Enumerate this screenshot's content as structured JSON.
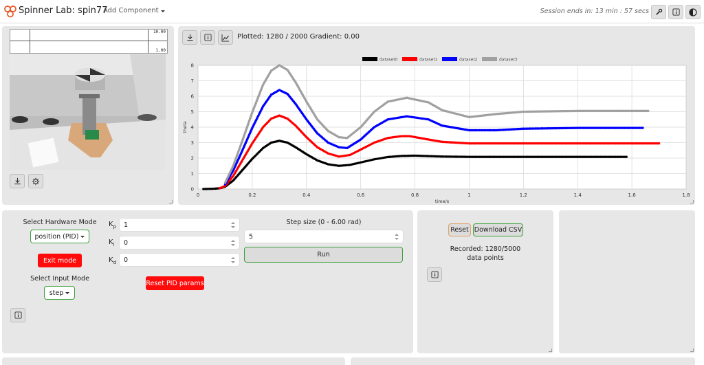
{
  "topbar": {
    "title": "Spinner Lab: spin77",
    "add_component": "Add Component",
    "session": "Session ends in: 13 min : 57 secs",
    "icons": [
      "wrench-icon",
      "info-icon",
      "contrast-icon"
    ]
  },
  "camera_panel": {
    "overlay_top": "10.00",
    "overlay_bottom": "1.00",
    "buttons": [
      "download-icon",
      "gear-icon"
    ]
  },
  "plot_panel": {
    "status": "Plotted: 1280 / 2000  Gradient: 0.00",
    "buttons": [
      "download-icon",
      "info-icon",
      "chart-icon"
    ]
  },
  "chart_data": {
    "type": "scatter",
    "xlabel": "time/s",
    "ylabel": "theta",
    "xlim": [
      0,
      1.8
    ],
    "ylim": [
      0,
      8
    ],
    "xticks": [
      "0",
      "0.2",
      "0.4",
      "0.6",
      "0.8",
      "1",
      "1.2",
      "1.4",
      "1.6",
      "1.8"
    ],
    "yticks": [
      "0",
      "1",
      "2",
      "3",
      "4",
      "5",
      "6",
      "7",
      "8"
    ],
    "grid": true,
    "legend_position": "top-center",
    "series": [
      {
        "name": "dataset0",
        "color": "#000000",
        "x": [
          0.02,
          0.06,
          0.08,
          0.1,
          0.13,
          0.16,
          0.2,
          0.24,
          0.27,
          0.3,
          0.33,
          0.36,
          0.4,
          0.44,
          0.48,
          0.52,
          0.56,
          0.6,
          0.65,
          0.7,
          0.75,
          0.8,
          0.9,
          1.0,
          1.2,
          1.4,
          1.58
        ],
        "y": [
          0.0,
          0.02,
          0.05,
          0.15,
          0.55,
          1.15,
          1.95,
          2.65,
          3.0,
          3.12,
          3.0,
          2.7,
          2.25,
          1.85,
          1.6,
          1.5,
          1.56,
          1.72,
          1.92,
          2.07,
          2.14,
          2.16,
          2.1,
          2.08,
          2.08,
          2.08,
          2.08
        ]
      },
      {
        "name": "dataset1",
        "color": "#ff0000",
        "x": [
          0.08,
          0.1,
          0.13,
          0.16,
          0.2,
          0.24,
          0.27,
          0.3,
          0.33,
          0.36,
          0.4,
          0.44,
          0.48,
          0.52,
          0.56,
          0.6,
          0.65,
          0.7,
          0.75,
          0.78,
          0.85,
          0.9,
          1.0,
          1.2,
          1.4,
          1.7
        ],
        "y": [
          0.05,
          0.2,
          0.85,
          1.75,
          2.95,
          4.0,
          4.55,
          4.75,
          4.55,
          4.1,
          3.35,
          2.7,
          2.3,
          2.1,
          2.2,
          2.55,
          3.0,
          3.3,
          3.42,
          3.42,
          3.2,
          3.05,
          2.95,
          2.95,
          2.95,
          2.95
        ]
      },
      {
        "name": "dataset2",
        "color": "#0000ff",
        "x": [
          0.1,
          0.13,
          0.16,
          0.2,
          0.24,
          0.27,
          0.3,
          0.33,
          0.36,
          0.4,
          0.44,
          0.48,
          0.52,
          0.55,
          0.6,
          0.65,
          0.7,
          0.77,
          0.85,
          0.9,
          1.0,
          1.1,
          1.2,
          1.4,
          1.64
        ],
        "y": [
          0.3,
          1.2,
          2.35,
          3.95,
          5.35,
          6.1,
          6.4,
          6.15,
          5.5,
          4.5,
          3.6,
          3.0,
          2.7,
          2.65,
          3.2,
          4.0,
          4.5,
          4.7,
          4.5,
          4.1,
          3.8,
          3.8,
          3.9,
          3.95,
          3.95
        ]
      },
      {
        "name": "dataset3",
        "color": "#a0a0a0",
        "x": [
          0.1,
          0.13,
          0.16,
          0.2,
          0.24,
          0.27,
          0.3,
          0.33,
          0.36,
          0.4,
          0.44,
          0.48,
          0.52,
          0.55,
          0.6,
          0.65,
          0.7,
          0.77,
          0.85,
          0.9,
          1.0,
          1.1,
          1.2,
          1.4,
          1.66
        ],
        "y": [
          0.4,
          1.5,
          2.95,
          4.95,
          6.75,
          7.65,
          8.0,
          7.7,
          6.9,
          5.65,
          4.5,
          3.75,
          3.35,
          3.3,
          4.0,
          5.0,
          5.65,
          5.9,
          5.6,
          5.1,
          4.65,
          4.85,
          5.0,
          5.05,
          5.05
        ]
      }
    ]
  },
  "controls": {
    "hw_mode_label": "Select Hardware Mode",
    "hw_mode_value": "position (PID)",
    "exit_mode": "Exit mode",
    "input_mode_label": "Select Input Mode",
    "input_mode_value": "step",
    "kp_label": "K",
    "kp_sub": "p",
    "kp_value": "1",
    "ki_label": "K",
    "ki_sub": "i",
    "ki_value": "0",
    "kd_label": "K",
    "kd_sub": "d",
    "kd_value": "0",
    "reset_pid": "Reset PID params",
    "step_size_label": "Step size (0 - 6.00 rad)",
    "step_value": "5",
    "run": "Run"
  },
  "recorder": {
    "reset": "Reset",
    "download_csv": "Download CSV",
    "recorded_line1": "Recorded: 1280/5000",
    "recorded_line2": "data points"
  }
}
